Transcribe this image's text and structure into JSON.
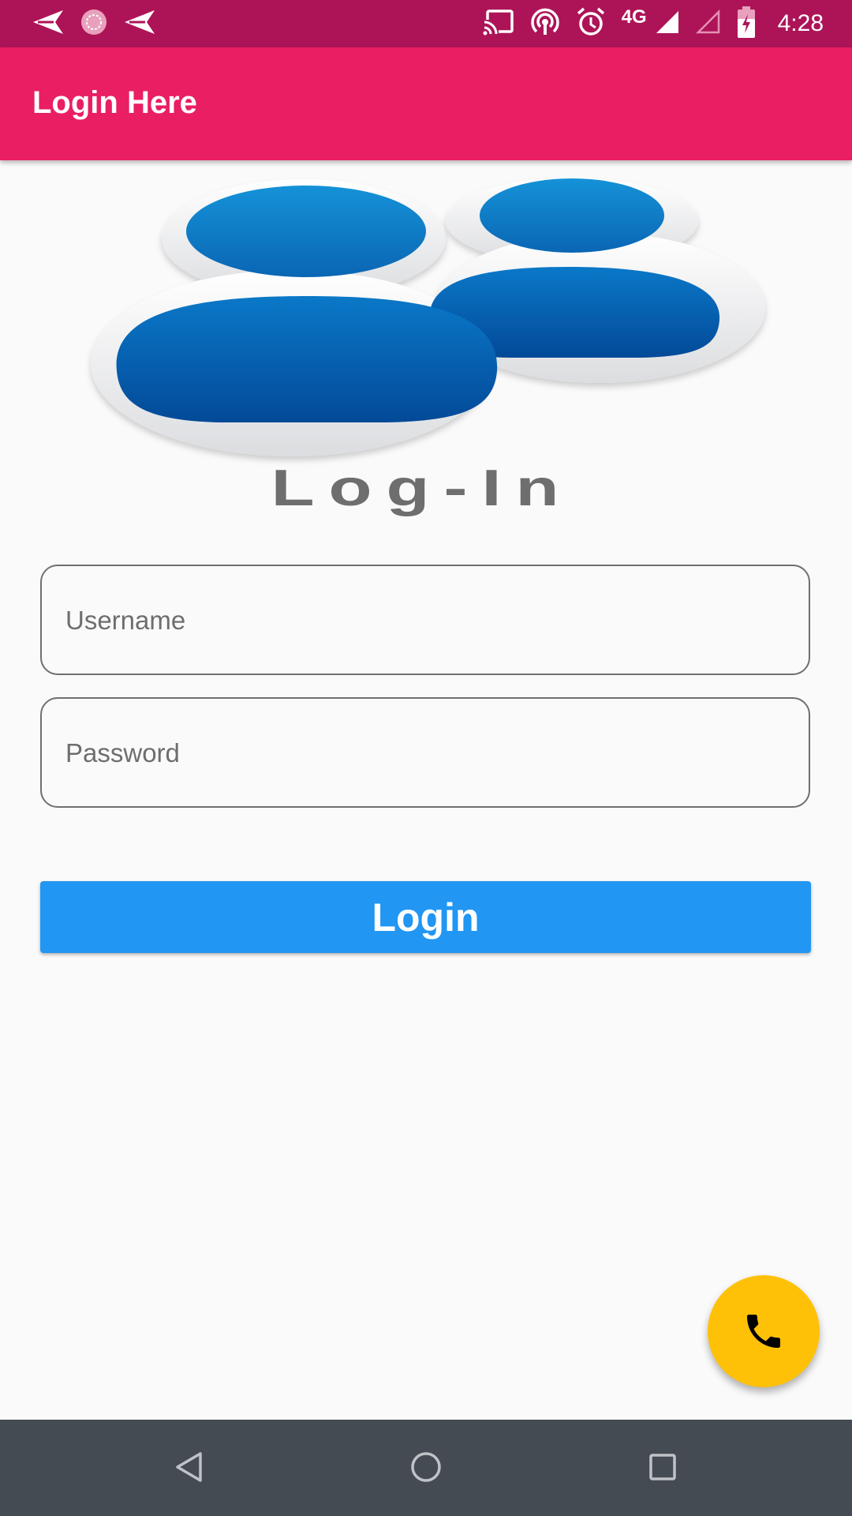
{
  "status_bar": {
    "time": "4:28",
    "network_type": "4G",
    "notification_icons": [
      "send-icon",
      "circle-app-icon",
      "send-icon"
    ],
    "system_icons": [
      "cast-icon",
      "hotspot-icon",
      "alarm-icon",
      "signal-icon",
      "signal-empty-icon",
      "battery-icon"
    ]
  },
  "app_bar": {
    "title": "Login Here",
    "color": "#e91e63"
  },
  "logo": {
    "text": "Log-In",
    "icon": "users-icon"
  },
  "form": {
    "username_placeholder": "Username",
    "username_value": "",
    "password_placeholder": "Password",
    "password_value": ""
  },
  "login_button": {
    "label": "Login",
    "color": "#2196f3"
  },
  "fab": {
    "icon": "phone-icon",
    "color": "#ffc107"
  },
  "nav_bar": {
    "buttons": [
      "back-icon",
      "home-icon",
      "recents-icon"
    ]
  }
}
